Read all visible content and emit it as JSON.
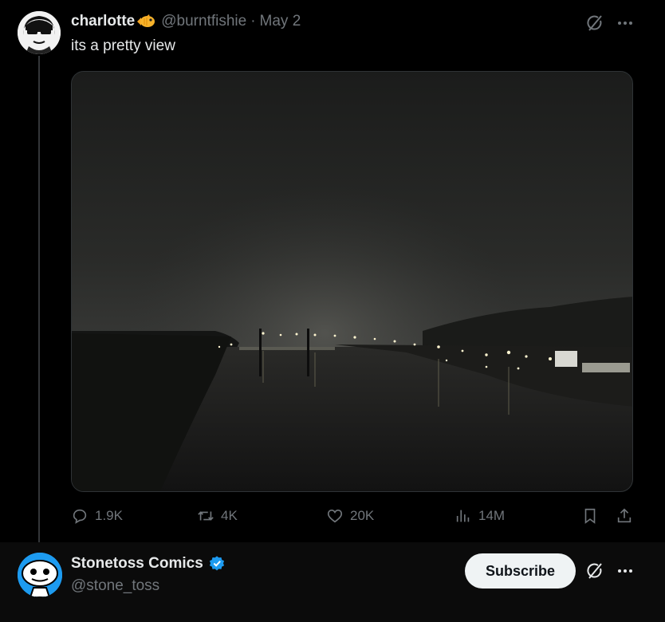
{
  "post": {
    "author_name": "charlotte",
    "handle": "@burntfishie",
    "separator": "·",
    "date": "May 2",
    "text": "its a pretty view",
    "stats": {
      "replies": "1.9K",
      "reposts": "4K",
      "likes": "20K",
      "views": "14M"
    }
  },
  "suggested": {
    "name": "Stonetoss Comics",
    "handle": "@stone_toss",
    "subscribe_label": "Subscribe"
  },
  "colors": {
    "background": "#000000",
    "muted_text": "#71767b",
    "verified_badge": "#1d9bf0",
    "button_bg": "#eff3f4"
  }
}
